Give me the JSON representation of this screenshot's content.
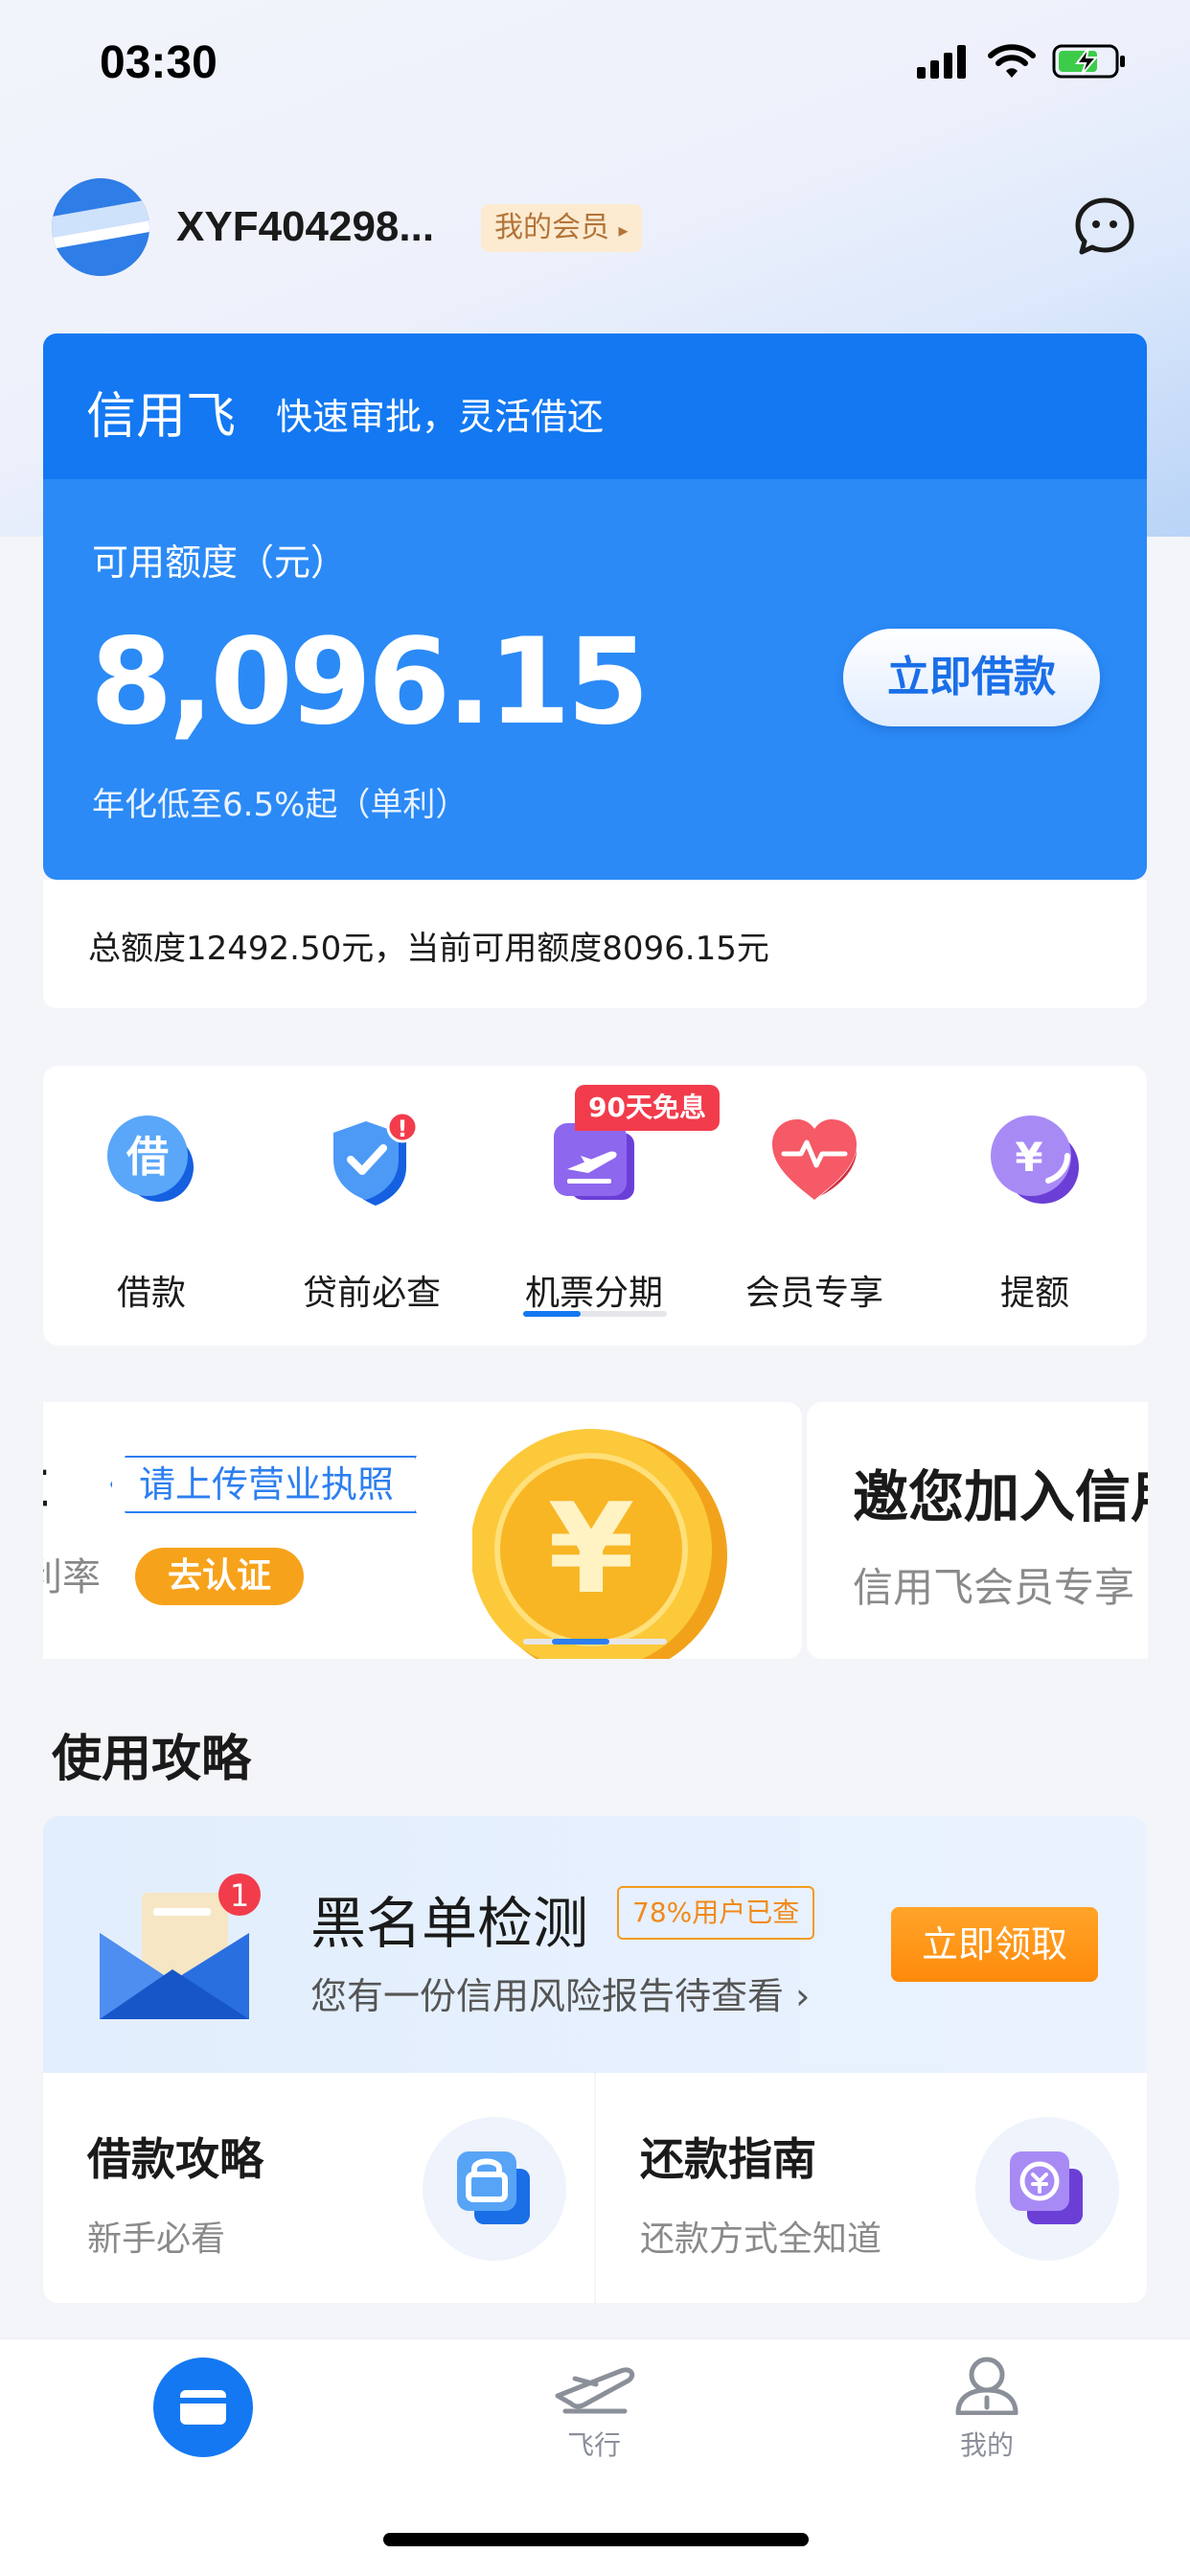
{
  "status_bar": {
    "time": "03:30"
  },
  "header": {
    "username": "XYF404298...",
    "member_badge": "我的会员"
  },
  "credit_card": {
    "brand": "信用飞",
    "slogan": "快速审批，灵活借还",
    "available_label": "可用额度（元）",
    "available_amount": "8,096.15",
    "rate_note": "年化低至6.5%起（单利）",
    "borrow_button": "立即借款",
    "total_text": "总额度12492.50元，当前可用额度8096.15元"
  },
  "services": {
    "items": [
      {
        "label": "借款",
        "icon": "borrow-icon",
        "icon_char": "借"
      },
      {
        "label": "贷前必查",
        "icon": "shield-check-icon",
        "badge": "!"
      },
      {
        "label": "机票分期",
        "icon": "plane-ticket-icon",
        "tag": "90天免息"
      },
      {
        "label": "会员专享",
        "icon": "heart-icon"
      },
      {
        "label": "提额",
        "icon": "yuan-up-icon",
        "icon_char": "¥"
      }
    ]
  },
  "banners": {
    "left": {
      "title": "享",
      "tag": "请上传营业执照",
      "subtitle": "利率",
      "button": "去认证",
      "coin_char": "¥"
    },
    "right": {
      "title": "邀您加入信用飞会员",
      "subtitle": "信用飞会员专享"
    }
  },
  "guide": {
    "section_title": "使用攻略",
    "promo": {
      "badge_count": "1",
      "title": "黑名单检测",
      "tag": "78%用户已查",
      "subtitle": "您有一份信用风险报告待查看",
      "chevron": "›",
      "button": "立即领取"
    },
    "cards": [
      {
        "title": "借款攻略",
        "subtitle": "新手必看",
        "icon": "lock-document-icon"
      },
      {
        "title": "还款指南",
        "subtitle": "还款方式全知道",
        "icon": "repay-icon"
      }
    ]
  },
  "tab_bar": {
    "items": [
      {
        "label": "",
        "icon": "card-icon",
        "active": true
      },
      {
        "label": "飞行",
        "icon": "plane-icon",
        "active": false
      },
      {
        "label": "我的",
        "icon": "user-icon",
        "active": false
      }
    ]
  },
  "colors": {
    "primary": "#1378f2",
    "orange": "#ff8a0a",
    "tag_red": "#f23c4c"
  }
}
